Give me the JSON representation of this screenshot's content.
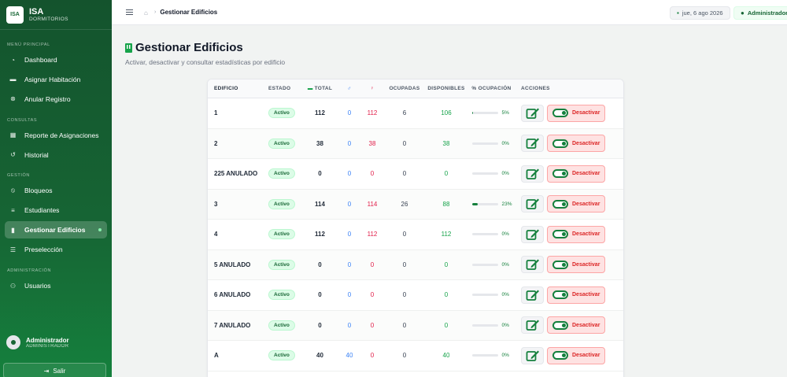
{
  "brand": {
    "logo": "ISA",
    "name": "ISA",
    "subtitle": "DORMITORIOS"
  },
  "sidebar": {
    "sections": [
      {
        "label": "MENÚ PRINCIPAL",
        "items": [
          {
            "label": "Dashboard",
            "icon": "gauge-icon"
          },
          {
            "label": "Asignar Habitación",
            "icon": "bed-icon"
          },
          {
            "label": "Anular Registro",
            "icon": "cancel-circle-icon"
          }
        ]
      },
      {
        "label": "CONSULTAS",
        "items": [
          {
            "label": "Reporte de Asignaciones",
            "icon": "table-icon"
          },
          {
            "label": "Historial",
            "icon": "history-icon"
          }
        ]
      },
      {
        "label": "GESTIÓN",
        "items": [
          {
            "label": "Bloqueos",
            "icon": "ban-icon"
          },
          {
            "label": "Estudiantes",
            "icon": "students-icon"
          },
          {
            "label": "Gestionar Edificios",
            "icon": "building-icon",
            "active": true
          },
          {
            "label": "Preselección",
            "icon": "list-check-icon"
          }
        ]
      },
      {
        "label": "ADMINISTRACIÓN",
        "items": [
          {
            "label": "Usuarios",
            "icon": "users-icon"
          }
        ]
      }
    ],
    "user": {
      "name": "Administrador",
      "role": "ADMINISTRADOR"
    },
    "logout": "Salir"
  },
  "topbar": {
    "breadcrumb": "Gestionar Edificios",
    "date": "jue, 6 ago 2026",
    "user": "Administrador"
  },
  "page": {
    "title": "Gestionar Edificios",
    "subtitle": "Activar, desactivar y consultar estadísticas por edificio"
  },
  "table": {
    "headers": {
      "edificio": "EDIFICIO",
      "estado": "ESTADO",
      "total": "TOTAL",
      "m": "♂",
      "f": "♀",
      "ocupadas": "OCUPADAS",
      "disponibles": "DISPONIBLES",
      "pct": "% OCUPACIÓN",
      "acciones": "ACCIONES"
    },
    "action_label": "Desactivar",
    "rows": [
      {
        "edificio": "1",
        "estado": "Activo",
        "total": "112",
        "m": "0",
        "f": "112",
        "ocupadas": "6",
        "disponibles": "106",
        "pct_label": "5%",
        "pct": 5
      },
      {
        "edificio": "2",
        "estado": "Activo",
        "total": "38",
        "m": "0",
        "f": "38",
        "ocupadas": "0",
        "disponibles": "38",
        "pct_label": "0%",
        "pct": 0
      },
      {
        "edificio": "225 ANULADO",
        "estado": "Activo",
        "total": "0",
        "m": "0",
        "f": "0",
        "ocupadas": "0",
        "disponibles": "0",
        "pct_label": "0%",
        "pct": 0
      },
      {
        "edificio": "3",
        "estado": "Activo",
        "total": "114",
        "m": "0",
        "f": "114",
        "ocupadas": "26",
        "disponibles": "88",
        "pct_label": "23%",
        "pct": 23
      },
      {
        "edificio": "4",
        "estado": "Activo",
        "total": "112",
        "m": "0",
        "f": "112",
        "ocupadas": "0",
        "disponibles": "112",
        "pct_label": "0%",
        "pct": 0
      },
      {
        "edificio": "5 ANULADO",
        "estado": "Activo",
        "total": "0",
        "m": "0",
        "f": "0",
        "ocupadas": "0",
        "disponibles": "0",
        "pct_label": "0%",
        "pct": 0
      },
      {
        "edificio": "6 ANULADO",
        "estado": "Activo",
        "total": "0",
        "m": "0",
        "f": "0",
        "ocupadas": "0",
        "disponibles": "0",
        "pct_label": "0%",
        "pct": 0
      },
      {
        "edificio": "7 ANULADO",
        "estado": "Activo",
        "total": "0",
        "m": "0",
        "f": "0",
        "ocupadas": "0",
        "disponibles": "0",
        "pct_label": "0%",
        "pct": 0
      },
      {
        "edificio": "A",
        "estado": "Activo",
        "total": "40",
        "m": "40",
        "f": "0",
        "ocupadas": "0",
        "disponibles": "40",
        "pct_label": "0%",
        "pct": 0
      }
    ]
  }
}
